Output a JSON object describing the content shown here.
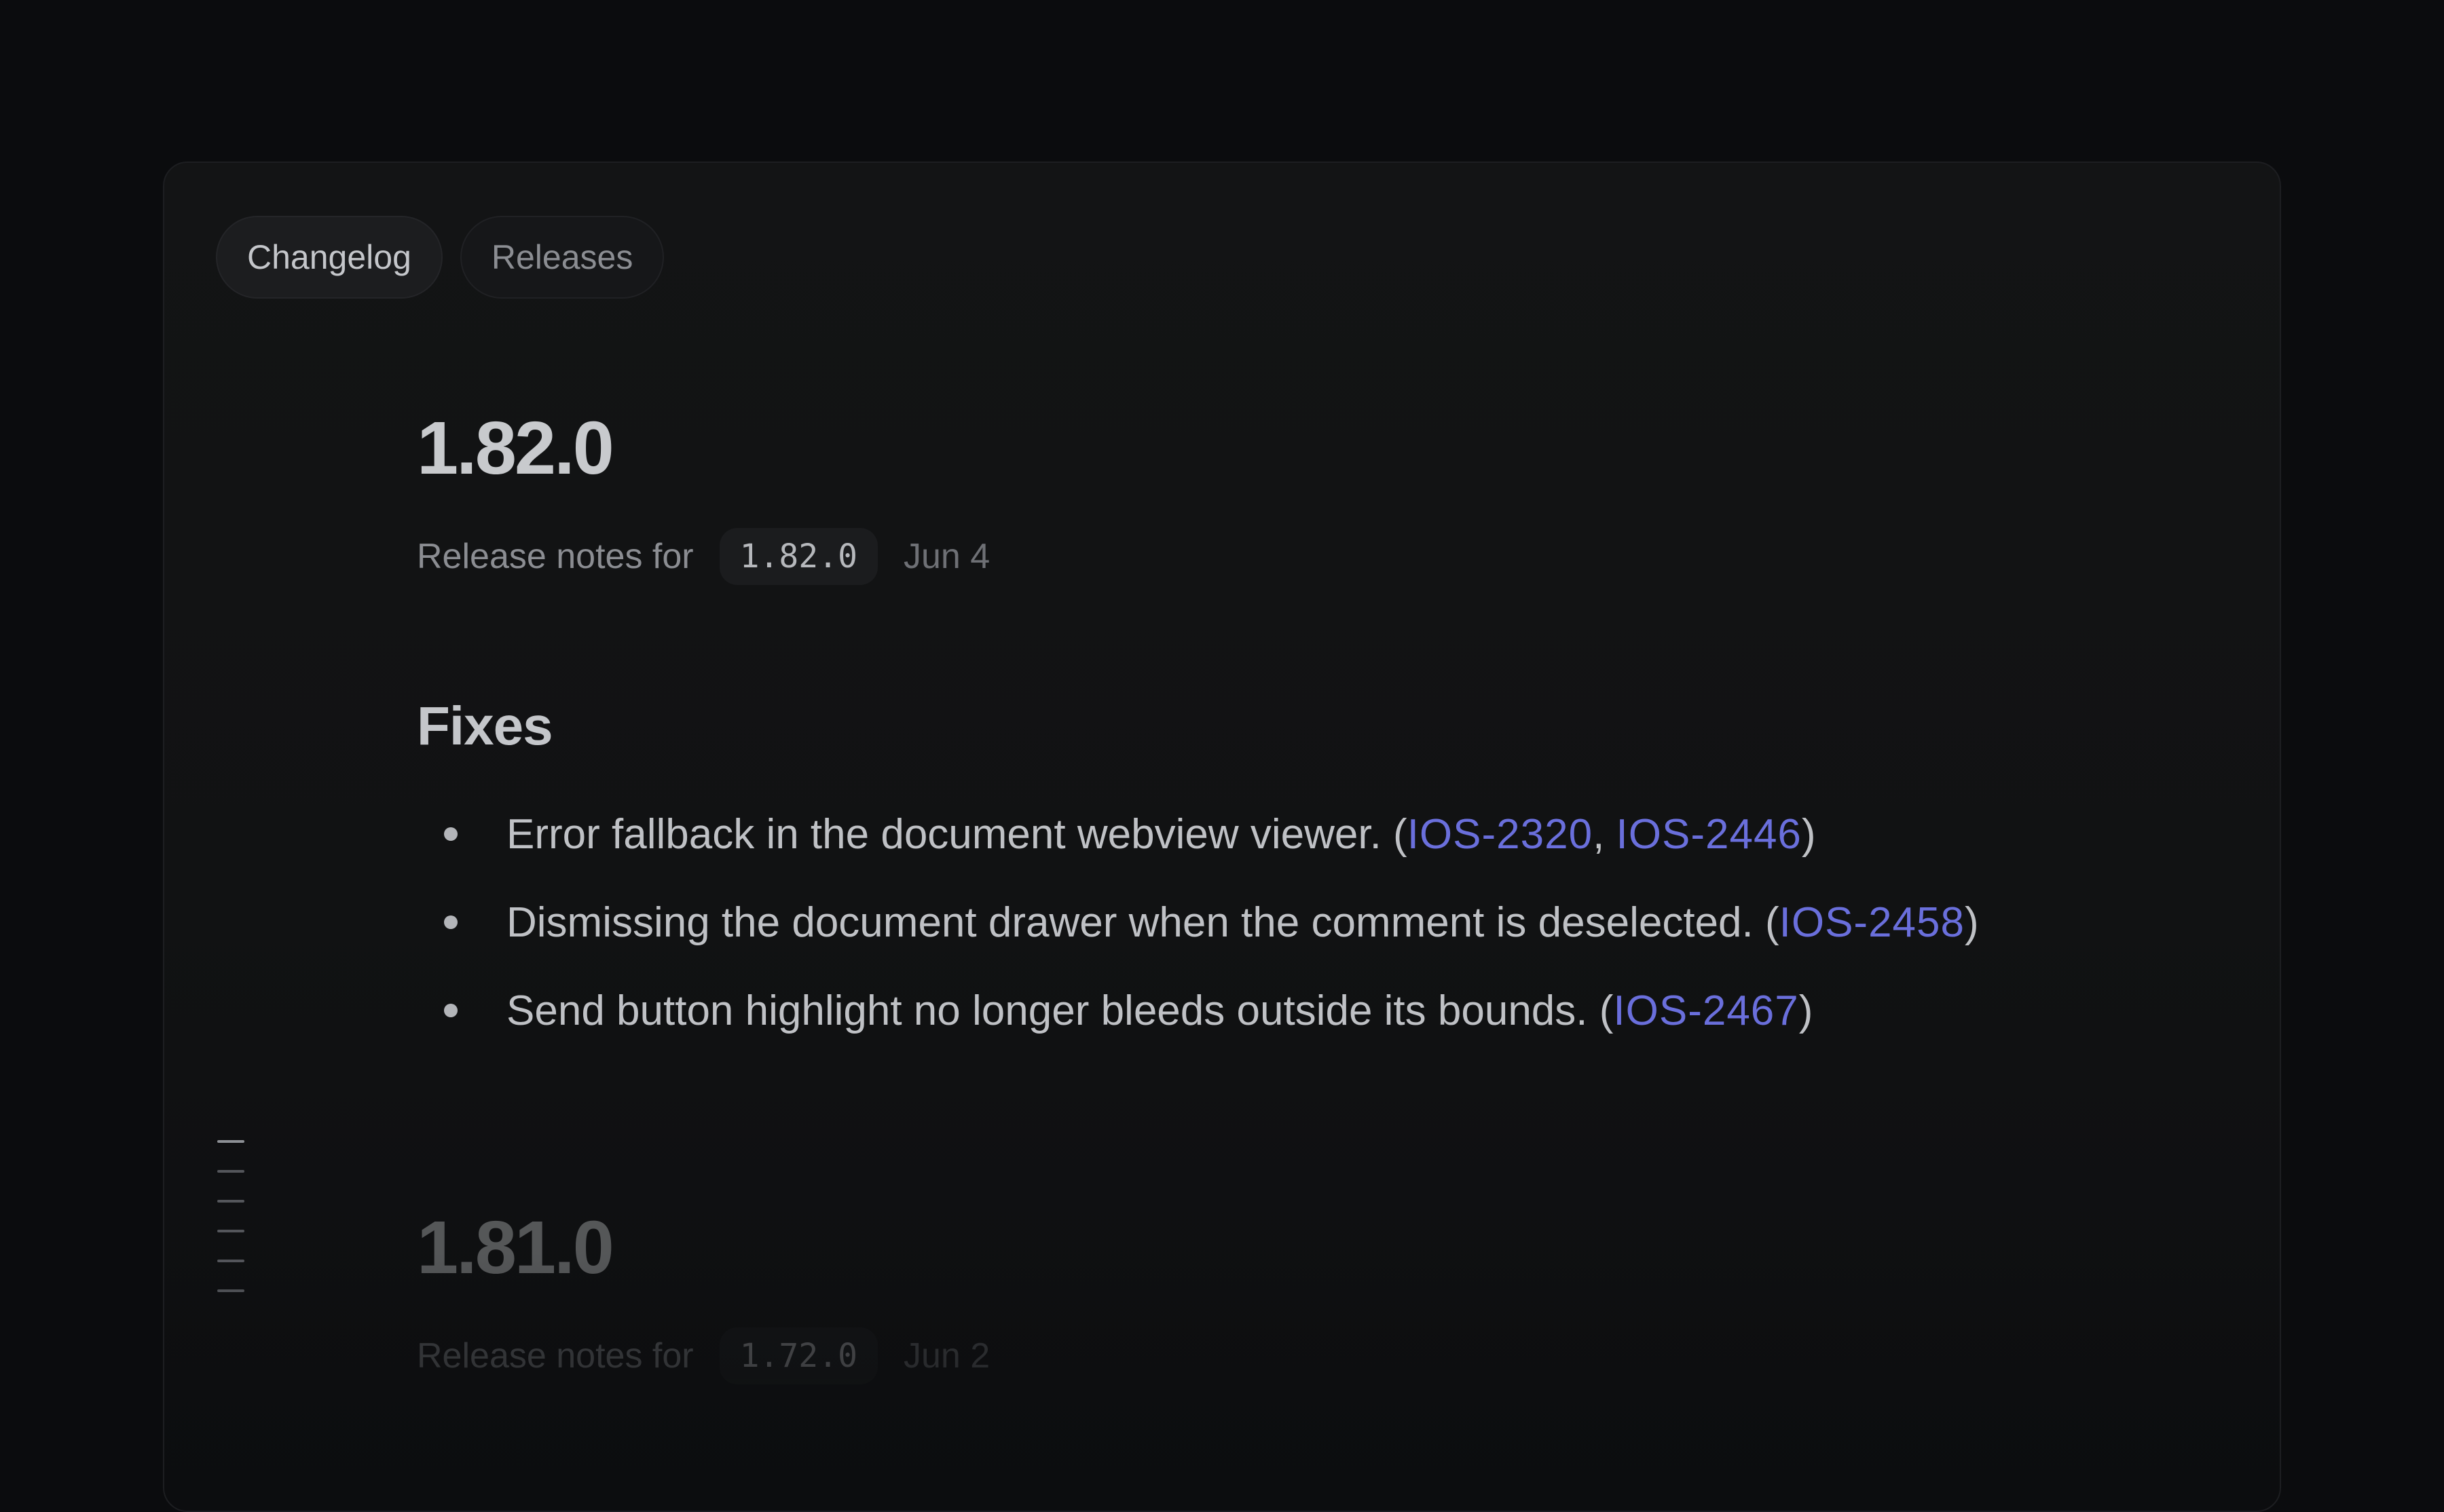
{
  "tabs": [
    {
      "label": "Changelog",
      "active": true
    },
    {
      "label": "Releases",
      "active": false
    }
  ],
  "releases": [
    {
      "version": "1.82.0",
      "notes_prefix": "Release notes for",
      "code": "1.82.0",
      "date": "Jun 4",
      "section": "Fixes",
      "fixes": [
        {
          "text": "Error fallback in the document webview viewer. (",
          "links": [
            "IOS-2320",
            "IOS-2446"
          ],
          "suffix": ")"
        },
        {
          "text": "Dismissing the document drawer when the comment is deselected. (",
          "links": [
            "IOS-2458"
          ],
          "suffix": ")"
        },
        {
          "text": "Send button highlight no longer bleeds outside its bounds. (",
          "links": [
            "IOS-2467"
          ],
          "suffix": ")"
        }
      ]
    },
    {
      "version": "1.81.0",
      "notes_prefix": "Release notes for",
      "code": "1.72.0",
      "date": "Jun 2"
    }
  ],
  "link_separator": ", ",
  "colors": {
    "background": "#0b0c0e",
    "card": "#131415",
    "link": "#6a6fdc",
    "text": "#bfc1c5"
  }
}
